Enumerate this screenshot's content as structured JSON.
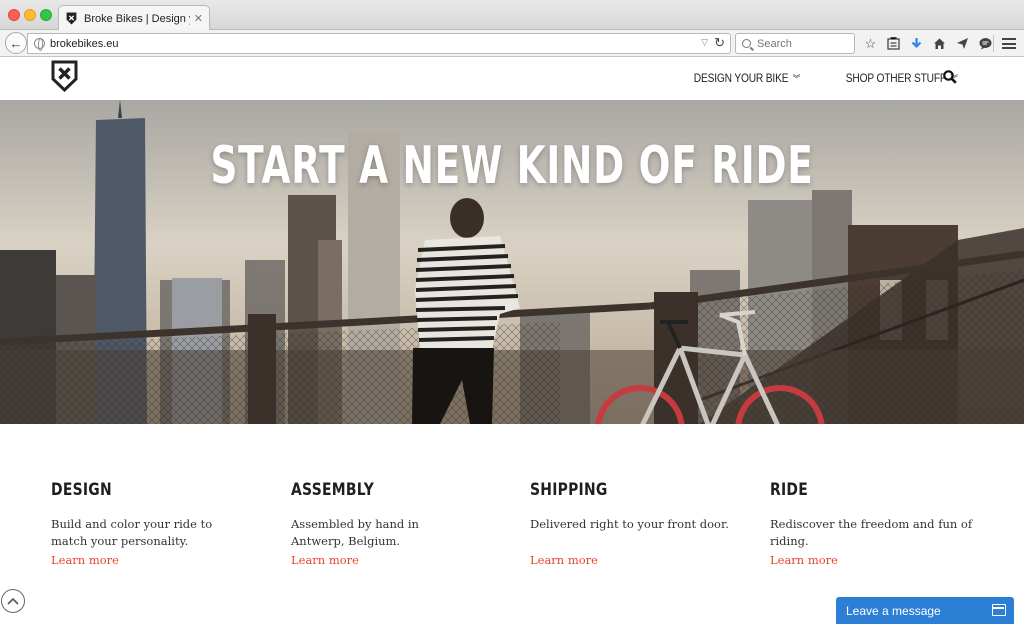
{
  "browser": {
    "tab_title": "Broke Bikes | Design your o...",
    "tab_close": "✕",
    "url": "brokebikes.eu",
    "search_placeholder": "Search"
  },
  "site": {
    "nav": [
      {
        "label": "DESIGN YOUR BIKE"
      },
      {
        "label": "SHOP OTHER STUFF"
      }
    ]
  },
  "hero": {
    "title": "START A NEW KIND OF RIDE"
  },
  "features": [
    {
      "title": "DESIGN",
      "text": "Build and color your ride to match your personality.",
      "link": "Learn more"
    },
    {
      "title": "ASSEMBLY",
      "text": "Assembled by hand in Antwerp, Belgium.",
      "link": "Learn more"
    },
    {
      "title": "SHIPPING",
      "text": "Delivered right to your front door.",
      "link": "Learn more"
    },
    {
      "title": "RIDE",
      "text": "Rediscover the freedom and fun of riding.",
      "link": "Learn more"
    }
  ],
  "chat": {
    "label": "Leave a message"
  },
  "colors": {
    "accent_link": "#e8452c",
    "chat_blue": "#2d7fd6"
  }
}
